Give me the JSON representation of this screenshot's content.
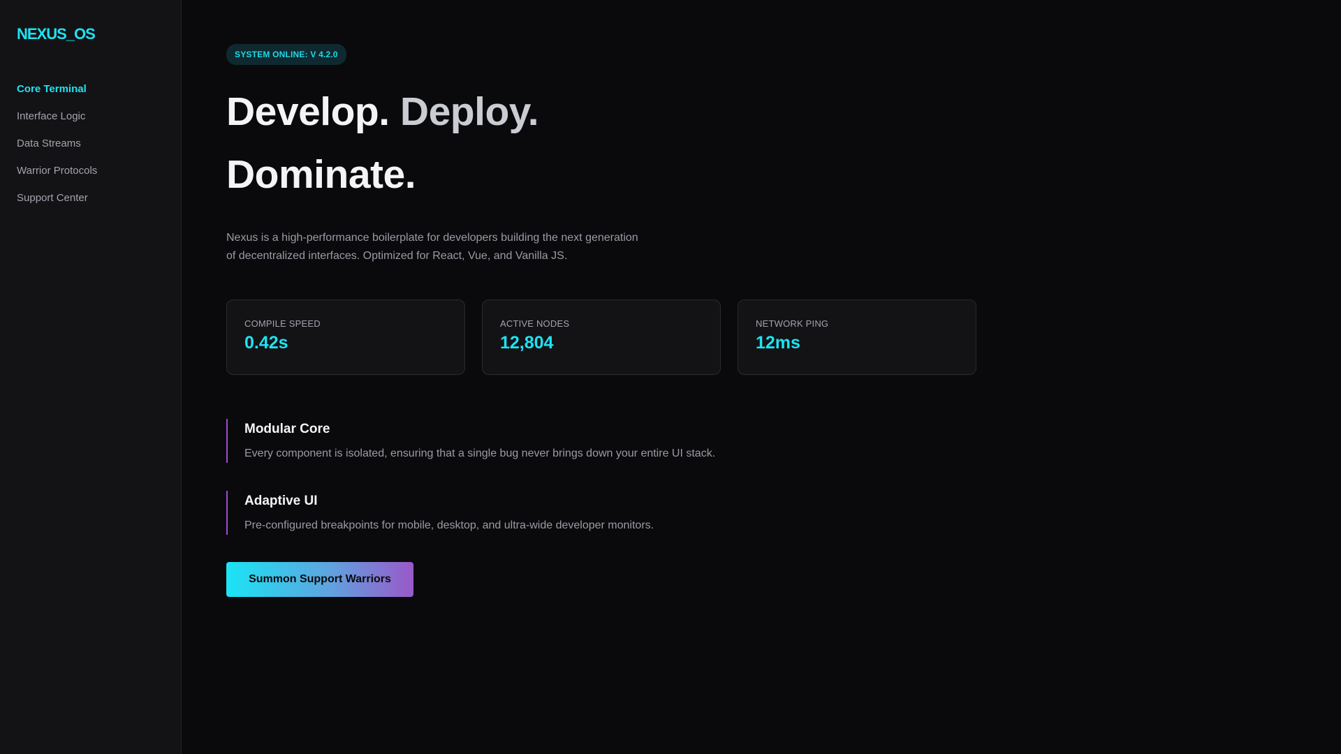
{
  "sidebar": {
    "logo": "NEXUS_OS",
    "items": [
      {
        "label": "Core Terminal",
        "active": true
      },
      {
        "label": "Interface Logic",
        "active": false
      },
      {
        "label": "Data Streams",
        "active": false
      },
      {
        "label": "Warrior Protocols",
        "active": false
      },
      {
        "label": "Support Center",
        "active": false
      }
    ]
  },
  "hero": {
    "badge": "SYSTEM ONLINE: V 4.2.0",
    "headline_word1": "Develop.",
    "headline_word2": "Deploy.",
    "headline_word3": "Dominate.",
    "lead": "Nexus is a high-performance boilerplate for developers building the next generation of decentralized interfaces. Optimized for React, Vue, and Vanilla JS."
  },
  "stats": [
    {
      "label": "COMPILE SPEED",
      "value": "0.42s"
    },
    {
      "label": "ACTIVE NODES",
      "value": "12,804"
    },
    {
      "label": "NETWORK PING",
      "value": "12ms"
    }
  ],
  "features": [
    {
      "title": "Modular Core",
      "desc": "Every component is isolated, ensuring that a single bug never brings down your entire UI stack."
    },
    {
      "title": "Adaptive UI",
      "desc": "Pre-configured breakpoints for mobile, desktop, and ultra-wide developer monitors."
    }
  ],
  "cta": {
    "label": "Summon Support Warriors"
  },
  "colors": {
    "accent_cyan": "#1ee3f2",
    "accent_purple": "#a04ad0",
    "background": "#0a0a0c",
    "sidebar_bg": "#131316"
  }
}
